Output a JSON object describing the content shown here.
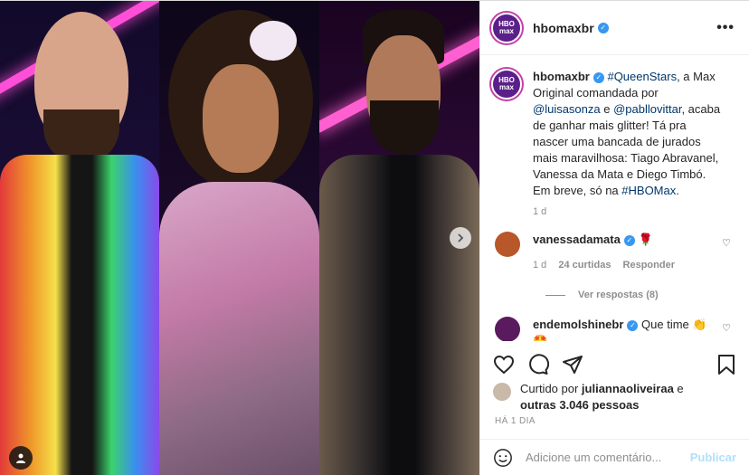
{
  "account": {
    "username": "hbomaxbr",
    "avatar_text": "HBO max",
    "verified": true
  },
  "header": {
    "more_label": "•••"
  },
  "caption": {
    "username": "hbomaxbr",
    "hashtag1": "#QueenStars",
    "t1": ", a Max Original comandada por ",
    "mention1": "@luisasonza",
    "t2": " e ",
    "mention2": "@pabllovittar",
    "t3": ", acaba de ganhar mais glitter! Tá pra nascer uma bancada de jurados mais maravilhosa: Tiago Abravanel, Vanessa da Mata e Diego Timbó.",
    "t4": "Em breve, só na ",
    "hashtag2": "#HBOMax",
    "t5": ".",
    "age": "1 d"
  },
  "comments": [
    {
      "username": "vanessadamata",
      "text": "🌹",
      "age": "1 d",
      "likes": "24 curtidas",
      "reply": "Responder",
      "view_replies": "Ver respostas (8)",
      "avatar_color": "#b8572a"
    },
    {
      "username": "endemolshinebr",
      "text": "Que time 👏",
      "text2": "🤩",
      "avatar_color": "#5a1a5e"
    }
  ],
  "likes": {
    "prefix": "Curtido por ",
    "user": "juliannaoliveiraa",
    "mid": " e",
    "others": "outras 3.046 pessoas"
  },
  "timestamp": "HÁ 1 DIA",
  "add_comment": {
    "placeholder": "Adicione um comentário...",
    "publish": "Publicar"
  },
  "icons": [
    "heart-icon",
    "comment-icon",
    "share-icon",
    "bookmark-icon",
    "emoji-icon",
    "next-arrow-icon",
    "tag-user-icon"
  ]
}
